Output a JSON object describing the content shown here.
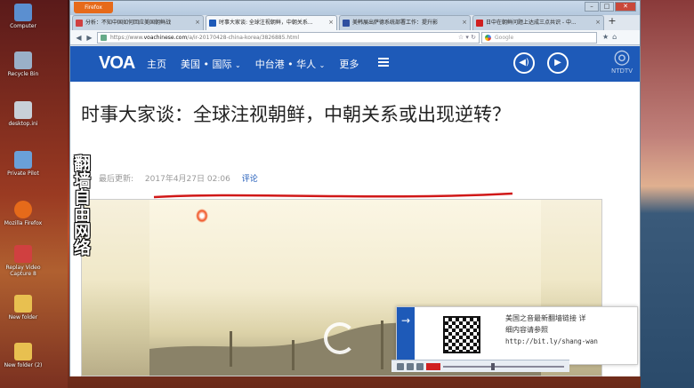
{
  "desktop": {
    "icons": [
      {
        "label": "Computer",
        "icon": "computer-icon",
        "color": "#5b8fd0"
      },
      {
        "label": "Recycle Bin",
        "icon": "recycle-bin-icon",
        "color": "#9ab0c8"
      },
      {
        "label": "desktop.ini",
        "icon": "file-icon",
        "color": "#c8d0d8"
      },
      {
        "label": "Private Pilot",
        "icon": "app-icon",
        "color": "#6aa0d8"
      },
      {
        "label": "Mozilla Firefox",
        "icon": "firefox-icon",
        "color": "#e66a1a"
      },
      {
        "label": "Replay Video Capture 8",
        "icon": "replay-video-icon",
        "color": "#d04040"
      },
      {
        "label": "New folder",
        "icon": "folder-icon",
        "color": "#e8c050"
      },
      {
        "label": "New folder (2)",
        "icon": "folder-icon",
        "color": "#e8c050"
      }
    ]
  },
  "browser": {
    "firefox_button": "Firefox",
    "tabs": [
      {
        "title": "分析：不知中国如何回应美国朝鲜战",
        "fav_color": "#d04040",
        "active": false
      },
      {
        "title": "时事大家谈: 全球注视朝鲜，中朝关系...",
        "fav_color": "#1e5ab8",
        "active": true
      },
      {
        "title": "美韩展出萨德系统部署工作：提升影",
        "fav_color": "#3050a0",
        "active": false
      },
      {
        "title": "日中在朝鲜问题上达成三点共识 - 中...",
        "fav_color": "#d02020",
        "active": false
      }
    ],
    "new_tab": "+",
    "url_prefix": "https://www.",
    "url_domain": "voachinese.com",
    "url_path": "/a/ir-20170428-china-korea/3826885.html",
    "search_placeholder": "Google",
    "search_engine_icon": "google-icon"
  },
  "page": {
    "logo": "VOA",
    "nav": [
      "主页",
      "美国 • 国际",
      "中台港 • 华人",
      "更多"
    ],
    "headline": "时事大家谈：全球注视朝鲜，中朝关系或出现逆转？",
    "meta_label": "最后更新:",
    "meta_date": "2017年4月27日 02:06",
    "meta_link": "评论",
    "watermark": "NTDTV",
    "overlay_text": "翻墙自由网络",
    "popup": {
      "line1": "美国之音最新翻墙链接 详",
      "line2": "细内容请参照",
      "url": "http://bit.ly/shang-wan"
    }
  },
  "colors": {
    "voa_blue": "#1e5ab8",
    "firefox_orange": "#e66a1a",
    "annotation_red": "#d01818"
  }
}
